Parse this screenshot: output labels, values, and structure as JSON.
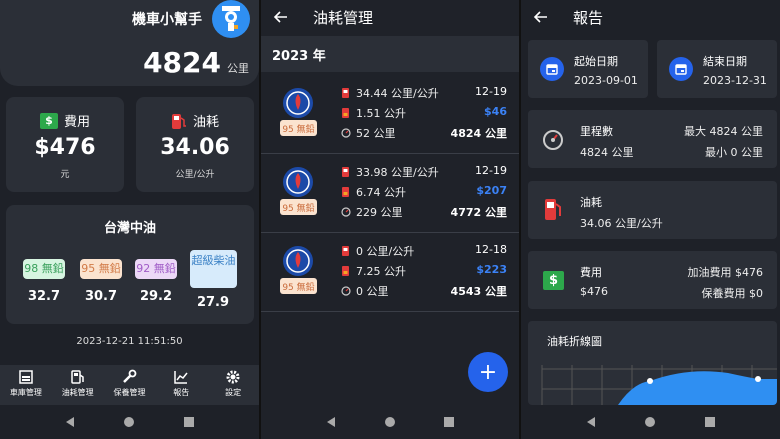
{
  "garage": {
    "app_title": "機車小幫手",
    "odometer_value": "4824",
    "odometer_unit": "公里",
    "expense_label": "費用",
    "expense_value": "$476",
    "expense_unit": "元",
    "fuel_label": "油耗",
    "fuel_value": "34.06",
    "fuel_unit": "公里/公升",
    "station_title": "台灣中油",
    "fuel_prices": [
      {
        "grade": "98 無鉛",
        "price": "32.7",
        "bg": "#d7f5e1",
        "fg": "#3aa05c"
      },
      {
        "grade": "95 無鉛",
        "price": "30.7",
        "bg": "#fbe3cf",
        "fg": "#d27b48"
      },
      {
        "grade": "92 無鉛",
        "price": "29.2",
        "bg": "#ecd8f7",
        "fg": "#a05cc7"
      },
      {
        "grade": "超級柴油",
        "price": "27.9",
        "bg": "#d7ebfb",
        "fg": "#3b82c6"
      }
    ],
    "datetime": "2023-12-21 11:51:50",
    "nav": [
      "車庫管理",
      "油耗管理",
      "保養管理",
      "報告",
      "設定"
    ]
  },
  "fuel_mgmt": {
    "title": "油耗管理",
    "year": "2023 年",
    "records": [
      {
        "efficiency": "34.44 公里/公升",
        "liters": "1.51 公升",
        "distance": "52 公里",
        "date": "12-19",
        "cost": "$46",
        "odometer": "4824 公里",
        "grade": "95 無鉛"
      },
      {
        "efficiency": "33.98 公里/公升",
        "liters": "6.74 公升",
        "distance": "229 公里",
        "date": "12-19",
        "cost": "$207",
        "odometer": "4772 公里",
        "grade": "95 無鉛"
      },
      {
        "efficiency": "0 公里/公升",
        "liters": "7.25 公升",
        "distance": "0 公里",
        "date": "12-18",
        "cost": "$223",
        "odometer": "4543 公里",
        "grade": "95 無鉛"
      }
    ],
    "fab_label": "+"
  },
  "report": {
    "title": "報告",
    "start_label": "起始日期",
    "start_date": "2023-09-01",
    "end_label": "結束日期",
    "end_date": "2023-12-31",
    "mileage_label": "里程數",
    "mileage_value": "4824 公里",
    "max_label": "最大 4824 公里",
    "min_label": "最小 0 公里",
    "fuel_label": "油耗",
    "fuel_value": "34.06 公里/公升",
    "expense_label": "費用",
    "expense_value": "$476",
    "refuel_cost": "加油費用 $476",
    "maint_cost": "保養費用 $0",
    "chart_title": "油耗折線圖"
  },
  "colors": {
    "accent": "#2563eb",
    "bg": "#1e2128",
    "card": "#2b2f37",
    "cost_blue": "#3b82f6"
  },
  "icons": [
    "back-arrow-icon",
    "dollar-icon",
    "gas-pump-icon",
    "calendar-icon",
    "speedometer-icon",
    "garage-icon",
    "wrench-icon",
    "chart-icon",
    "gear-icon"
  ]
}
